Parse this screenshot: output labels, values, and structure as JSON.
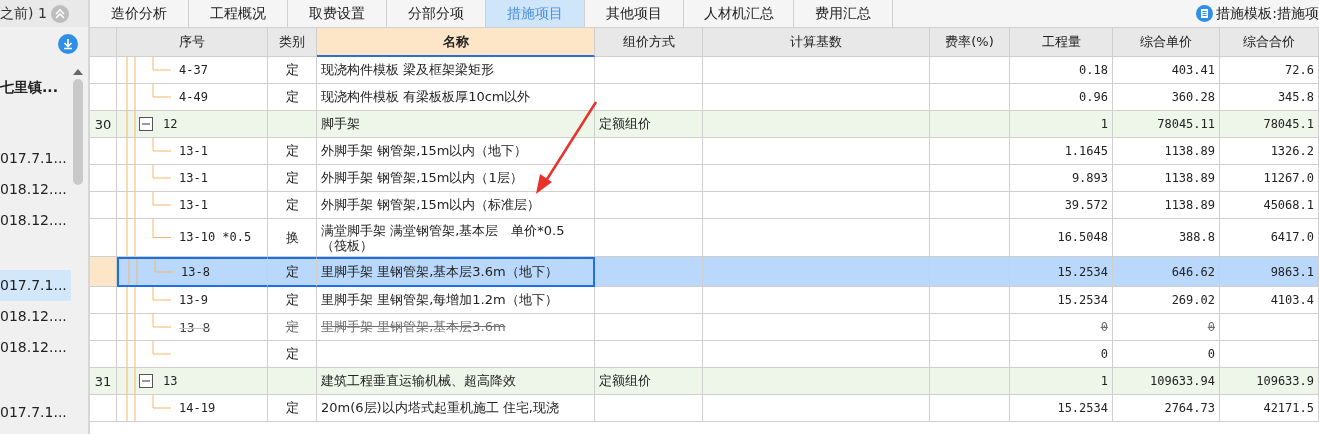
{
  "sidebar": {
    "title": "之前) 1",
    "project": {
      "name": "七里镇..."
    },
    "groups": [
      {
        "items": [
          {
            "label": "017.7.1...",
            "selected": false
          },
          {
            "label": "018.12....",
            "selected": false
          },
          {
            "label": "018.12....",
            "selected": false
          }
        ]
      },
      {
        "items": [
          {
            "label": "017.7.1...",
            "selected": true
          },
          {
            "label": "018.12....",
            "selected": false
          },
          {
            "label": "018.12....",
            "selected": false
          }
        ]
      },
      {
        "items": [
          {
            "label": "017.7.1...",
            "selected": false
          }
        ]
      }
    ]
  },
  "tabs": [
    {
      "label": "造价分析",
      "selected": false
    },
    {
      "label": "工程概况",
      "selected": false
    },
    {
      "label": "取费设置",
      "selected": false
    },
    {
      "label": "分部分项",
      "selected": false
    },
    {
      "label": "措施项目",
      "selected": true
    },
    {
      "label": "其他项目",
      "selected": false
    },
    {
      "label": "人材机汇总",
      "selected": false
    },
    {
      "label": "费用汇总",
      "selected": false
    }
  ],
  "template_label": "措施模板:措施项",
  "table": {
    "columns": [
      {
        "selected": false
      },
      {
        "label": "序号",
        "selected": false
      },
      {
        "label": "类别",
        "selected": false
      },
      {
        "label": "名称",
        "selected": true
      },
      {
        "label": "组价方式",
        "selected": false
      },
      {
        "label": "计算基数",
        "selected": false
      },
      {
        "label": "费率(%)",
        "selected": false
      },
      {
        "label": "工程量",
        "selected": false
      },
      {
        "label": "综合单价",
        "selected": false
      },
      {
        "label": "综合合价",
        "selected": false
      }
    ],
    "rows": [
      {
        "kind": "item",
        "code": "4-37",
        "type": "定",
        "name": "现浇构件模板 梁及框架梁矩形",
        "quantity": "0.18",
        "unit_price": "403.41",
        "total": "72.6",
        "selected": false,
        "struck": false
      },
      {
        "kind": "item",
        "code": "4-49",
        "type": "定",
        "name": "现浇构件模板 有梁板板厚10cm以外",
        "quantity": "0.96",
        "unit_price": "360.28",
        "total": "345.8",
        "selected": false,
        "struck": false
      },
      {
        "kind": "group",
        "number": "30",
        "code": "12",
        "name": "脚手架",
        "method": "定额组价",
        "quantity": "1",
        "unit_price": "78045.11",
        "total": "78045.1",
        "expanded": true,
        "selected": false,
        "struck": false,
        "children": [
          {
            "kind": "item",
            "code": "13-1",
            "type": "定",
            "name": "外脚手架 钢管架,15m以内（地下）",
            "quantity": "1.1645",
            "unit_price": "1138.89",
            "total": "1326.2",
            "selected": false,
            "struck": false
          },
          {
            "kind": "item",
            "code": "13-1",
            "type": "定",
            "name": "外脚手架 钢管架,15m以内（1层）",
            "quantity": "9.893",
            "unit_price": "1138.89",
            "total": "11267.0",
            "selected": false,
            "struck": false
          },
          {
            "kind": "item",
            "code": "13-1",
            "type": "定",
            "name": "外脚手架 钢管架,15m以内（标准层）",
            "quantity": "39.572",
            "unit_price": "1138.89",
            "total": "45068.1",
            "selected": false,
            "struck": false
          },
          {
            "kind": "item",
            "code": "13-10 *0.5",
            "type": "换",
            "name": "满堂脚手架 满堂钢管架,基本层　单价*0.5（筏板）",
            "quantity": "16.5048",
            "unit_price": "388.8",
            "total": "6417.0",
            "selected": false,
            "struck": false
          },
          {
            "kind": "item",
            "code": "13-8",
            "type": "定",
            "name": "里脚手架 里钢管架,基本层3.6m（地下）",
            "quantity": "15.2534",
            "unit_price": "646.62",
            "total": "9863.1",
            "selected": true,
            "struck": false
          },
          {
            "kind": "item",
            "code": "13-9",
            "type": "定",
            "name": "里脚手架 里钢管架,每增加1.2m（地下）",
            "quantity": "15.2534",
            "unit_price": "269.02",
            "total": "4103.4",
            "selected": false,
            "struck": false
          },
          {
            "kind": "item",
            "code": "13-8",
            "type": "定",
            "name": "里脚手架 里钢管架,基本层3.6m",
            "quantity": "0",
            "unit_price": "0",
            "selected": false,
            "struck": true
          },
          {
            "kind": "item",
            "type": "定",
            "quantity": "0",
            "unit_price": "0",
            "selected": false,
            "struck": false
          }
        ]
      },
      {
        "kind": "group",
        "number": "31",
        "code": "13",
        "name": "建筑工程垂直运输机械、超高降效",
        "method": "定额组价",
        "quantity": "1",
        "unit_price": "109633.94",
        "total": "109633.9",
        "expanded": true,
        "selected": false,
        "struck": false,
        "children": [
          {
            "kind": "item",
            "code": "14-19",
            "type": "定",
            "name": "20m(6层)以内塔式起重机施工 住宅,现浇",
            "quantity": "15.2534",
            "unit_price": "2764.73",
            "total": "42171.5",
            "selected": false,
            "struck": false
          }
        ]
      }
    ]
  }
}
